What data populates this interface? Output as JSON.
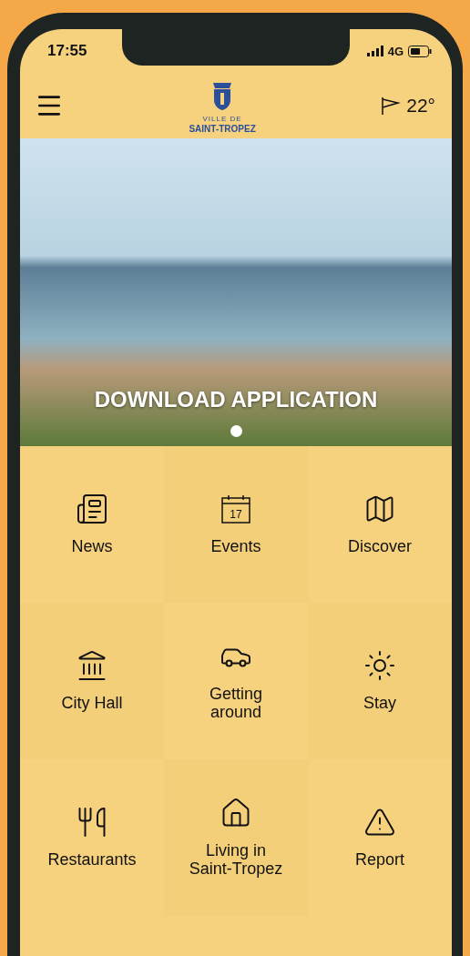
{
  "status_bar": {
    "time": "17:55",
    "network": "4G"
  },
  "header": {
    "logo_small": "VILLE DE",
    "logo_name": "SAINT-TROPEZ",
    "temperature": "22°"
  },
  "hero": {
    "caption": "DOWNLOAD APPLICATION",
    "dots": [
      {
        "selected": true
      }
    ]
  },
  "tiles": [
    {
      "kind": "news",
      "label": "News"
    },
    {
      "kind": "calendar",
      "label": "Events",
      "icon_text": "17"
    },
    {
      "kind": "map",
      "label": "Discover"
    },
    {
      "kind": "cityhall",
      "label": "City Hall"
    },
    {
      "kind": "car",
      "label": "Getting around"
    },
    {
      "kind": "sun",
      "label": "Stay"
    },
    {
      "kind": "cutlery",
      "label": "Restaurants"
    },
    {
      "kind": "house",
      "label": "Living in Saint-Tropez"
    },
    {
      "kind": "warning",
      "label": "Report"
    }
  ]
}
